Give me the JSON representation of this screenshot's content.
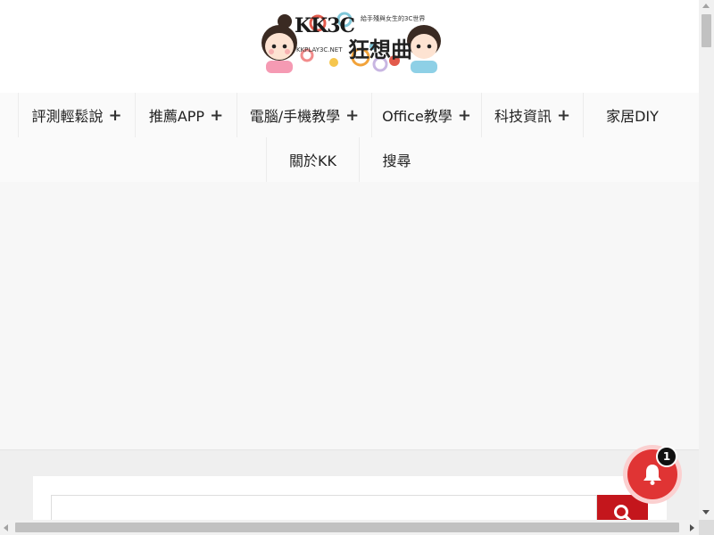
{
  "site": {
    "logo_title": "KK3C",
    "logo_subtitle_cn": "狂想曲",
    "logo_tagline": "給手殘與女生的3C世界",
    "logo_url": "KKPLAY3C.NET"
  },
  "nav": {
    "row1": [
      {
        "label": "評測輕鬆說",
        "has_submenu": true
      },
      {
        "label": "推薦APP",
        "has_submenu": true
      },
      {
        "label": "電腦/手機教學",
        "has_submenu": true
      },
      {
        "label": "Office教學",
        "has_submenu": true
      },
      {
        "label": "科技資訊",
        "has_submenu": true
      },
      {
        "label": "家居DIY",
        "has_submenu": false
      }
    ],
    "row2": [
      {
        "label": "關於KK",
        "has_submenu": false
      },
      {
        "label": "搜尋",
        "has_submenu": false
      }
    ],
    "submenu_symbol": "+"
  },
  "search": {
    "placeholder": "",
    "button_icon": "search-icon"
  },
  "notification": {
    "icon": "bell-icon",
    "count": "1"
  },
  "colors": {
    "accent_red": "#c4161c",
    "bell_red": "#e03434"
  }
}
